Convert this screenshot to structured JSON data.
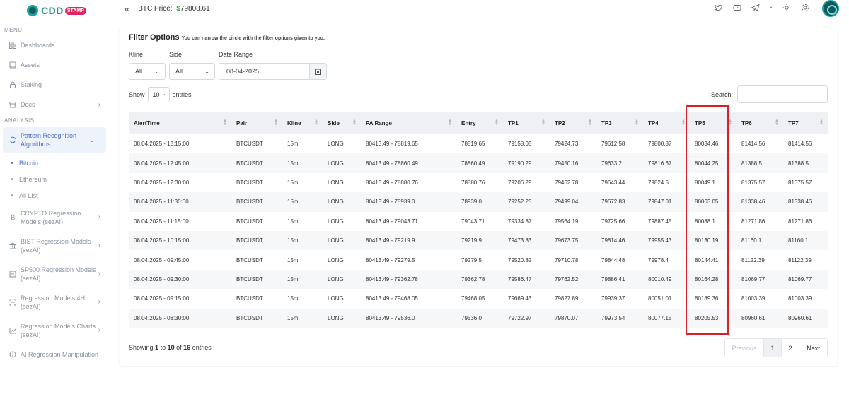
{
  "brand": {
    "name": "CDD",
    "badge": "STAMP"
  },
  "topbar": {
    "collapse_icon": "double-chevron-left",
    "price_label": "BTC Price:",
    "price_symbol": "$",
    "price_value": "79808.61"
  },
  "sidebar": {
    "menu_label": "MENU",
    "analysis_label": "ANALYSIS",
    "menu_items": [
      {
        "label": "Dashboards",
        "icon": "grid-icon"
      },
      {
        "label": "Assets",
        "icon": "wallet-icon"
      },
      {
        "label": "Staking",
        "icon": "lock-icon"
      },
      {
        "label": "Docs",
        "icon": "archive-icon"
      }
    ],
    "analysis_items": [
      {
        "line1": "Pattern Recognition",
        "line2": "Algorithms",
        "icon": "refresh-icon"
      },
      {
        "line1": "CRYPTO Regression",
        "line2": "Models (sezAI)",
        "icon": "bitcoin-icon"
      },
      {
        "line1": "BIST Regression Models",
        "line2": "(sezAI)",
        "icon": "bank-icon"
      },
      {
        "line1": "SP500 Regression Models",
        "line2": "(sezAI)",
        "icon": "chart-box-icon"
      },
      {
        "line1": "Regression Models 4H",
        "line2": "(sezAI)",
        "icon": "scan-icon"
      },
      {
        "line1": "Regression Models Charts",
        "line2": "(sezAI)",
        "icon": "line-chart-icon"
      },
      {
        "line1": "AI Regression Manipulation",
        "icon": "info-icon"
      }
    ],
    "sub_items": [
      "Bitcoin",
      "Ethereum",
      "All List"
    ]
  },
  "filter": {
    "title": "Filter Options",
    "subtitle": "You can narrow the circle with the filter options given to you.",
    "kline_label": "Kline",
    "kline_value": "All",
    "side_label": "Side",
    "side_value": "All",
    "date_label": "Date Range",
    "date_value": "08-04-2025"
  },
  "list": {
    "show_label": "Show",
    "entries_value": "10",
    "entries_label": "entries",
    "search_label": "Search:",
    "info_prefix": "Showing",
    "info_from": "1",
    "info_to_word": "to",
    "info_to": "10",
    "info_of_word": "of",
    "info_total": "16",
    "info_suffix": "entries"
  },
  "table": {
    "columns": [
      "AlertTime",
      "Pair",
      "Kline",
      "Side",
      "PA Range",
      "Entry",
      "TP1",
      "TP2",
      "TP3",
      "TP4",
      "TP5",
      "TP6",
      "TP7"
    ],
    "rows": [
      [
        "08.04.2025 - 13:15:00",
        "BTCUSDT",
        "15m",
        "LONG",
        "80413.49 - 78819.65",
        "78819.65",
        "79158.05",
        "79424.73",
        "79612.58",
        "79800.87",
        "80034.46",
        "81414.56",
        "81414.56"
      ],
      [
        "08.04.2025 - 12:45:00",
        "BTCUSDT",
        "15m",
        "LONG",
        "80413.49 - 78860.49",
        "78860.49",
        "79190.29",
        "79450.16",
        "79633.2",
        "79816.67",
        "80044.25",
        "81388.5",
        "81388.5"
      ],
      [
        "08.04.2025 - 12:30:00",
        "BTCUSDT",
        "15m",
        "LONG",
        "80413.49 - 78880.76",
        "78880.76",
        "79206.29",
        "79462.78",
        "79643.44",
        "79824.5",
        "80049.1",
        "81375.57",
        "81375.57"
      ],
      [
        "08.04.2025 - 11:30:00",
        "BTCUSDT",
        "15m",
        "LONG",
        "80413.49 - 78939.0",
        "78939.0",
        "79252.25",
        "79499.04",
        "79672.83",
        "79847.01",
        "80063.05",
        "81338.46",
        "81338.46"
      ],
      [
        "08.04.2025 - 11:15:00",
        "BTCUSDT",
        "15m",
        "LONG",
        "80413.49 - 79043.71",
        "79043.71",
        "79334.87",
        "79564.19",
        "79725.66",
        "79887.45",
        "80088.1",
        "81271.86",
        "81271.86"
      ],
      [
        "08.04.2025 - 10:15:00",
        "BTCUSDT",
        "15m",
        "LONG",
        "80413.49 - 79219.9",
        "79219.9",
        "79473.83",
        "79673.75",
        "79814.46",
        "79955.43",
        "80130.19",
        "81160.1",
        "81160.1"
      ],
      [
        "08.04.2025 - 09:45:00",
        "BTCUSDT",
        "15m",
        "LONG",
        "80413.49 - 79279.5",
        "79279.5",
        "79520.82",
        "79710.78",
        "79844.48",
        "79978.4",
        "80144.41",
        "81122.39",
        "81122.39"
      ],
      [
        "08.04.2025 - 09:30:00",
        "BTCUSDT",
        "15m",
        "LONG",
        "80413.49 - 79362.78",
        "79362.78",
        "79586.47",
        "79762.52",
        "79886.41",
        "80010.49",
        "80164.28",
        "81069.77",
        "81069.77"
      ],
      [
        "08.04.2025 - 09:15:00",
        "BTCUSDT",
        "15m",
        "LONG",
        "80413.49 - 79468.05",
        "79468.05",
        "79669.43",
        "79827.89",
        "79939.37",
        "80051.01",
        "80189.36",
        "81003.39",
        "81003.39"
      ],
      [
        "08.04.2025 - 08:30:00",
        "BTCUSDT",
        "15m",
        "LONG",
        "80413.49 - 79536.0",
        "79536.0",
        "79722.97",
        "79870.07",
        "79973.54",
        "80077.15",
        "80205.53",
        "80960.61",
        "80960.61"
      ]
    ]
  },
  "pagination": {
    "previous": "Previous",
    "pages": [
      "1",
      "2"
    ],
    "next": "Next"
  },
  "colors": {
    "accent": "#4a72c4",
    "highlight": "#d7202a",
    "price": "#2aa84a"
  }
}
